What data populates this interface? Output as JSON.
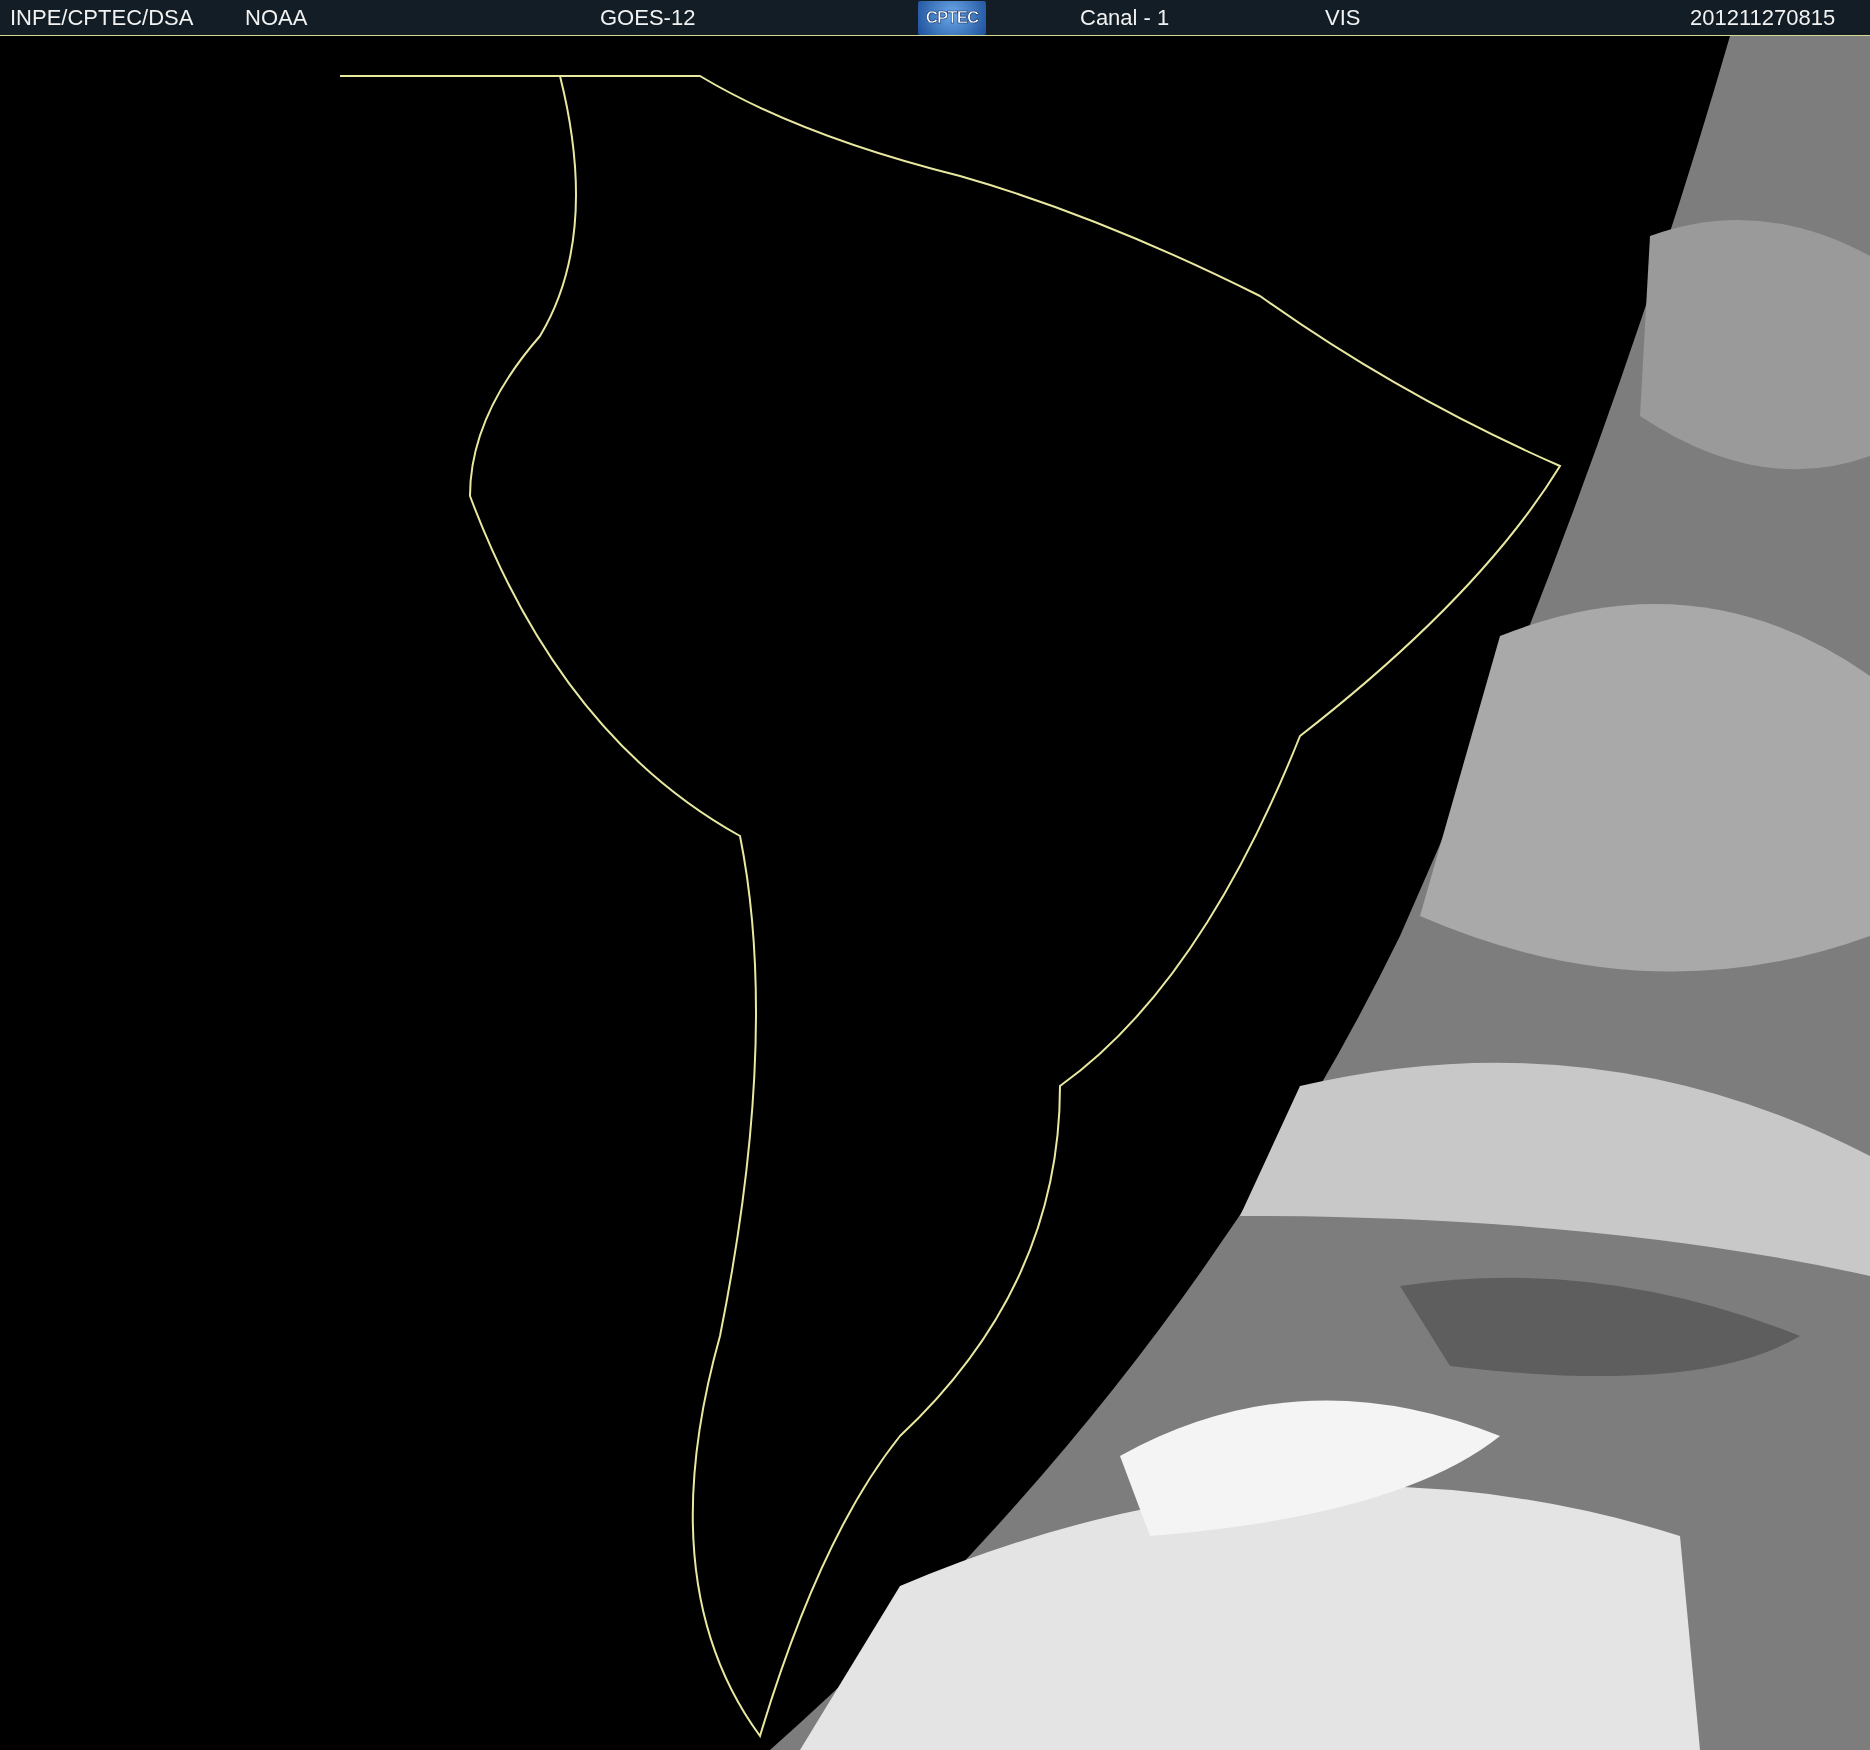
{
  "header": {
    "items": [
      {
        "kind": "text",
        "text": "INPE/CPTEC/DSA"
      },
      {
        "kind": "text",
        "text": "NOAA"
      },
      {
        "kind": "text",
        "text": "GOES-12"
      },
      {
        "kind": "logo",
        "text": "CPTEC"
      },
      {
        "kind": "text",
        "text": "Canal - 1"
      },
      {
        "kind": "text",
        "text": "VIS"
      },
      {
        "kind": "text",
        "text": "201211270815"
      }
    ]
  }
}
